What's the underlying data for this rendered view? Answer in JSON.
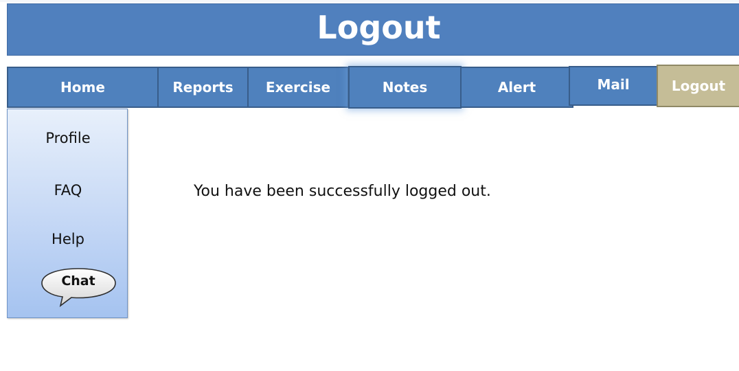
{
  "header": {
    "title": "Logout"
  },
  "nav": {
    "tabs": [
      {
        "label": "Home"
      },
      {
        "label": "Reports"
      },
      {
        "label": "Exercise"
      },
      {
        "label": "Notes"
      },
      {
        "label": "Alert"
      },
      {
        "label": "Mail"
      },
      {
        "label": "Logout",
        "active": true
      }
    ]
  },
  "sidebar": {
    "items": [
      {
        "label": "Profile"
      },
      {
        "label": "FAQ"
      },
      {
        "label": "Help"
      }
    ],
    "chat_label": "Chat"
  },
  "main": {
    "message": "You have been successfully logged out."
  },
  "colors": {
    "header_bg": "#5080be",
    "tab_bg": "#4f81bd",
    "tab_border": "#385d8a",
    "active_tab_bg": "#c5bd97",
    "sidebar_gradient_top": "#e8f0fb",
    "sidebar_gradient_bottom": "#a5c3f0"
  },
  "icons": {
    "chat": "speech-bubble-icon"
  }
}
